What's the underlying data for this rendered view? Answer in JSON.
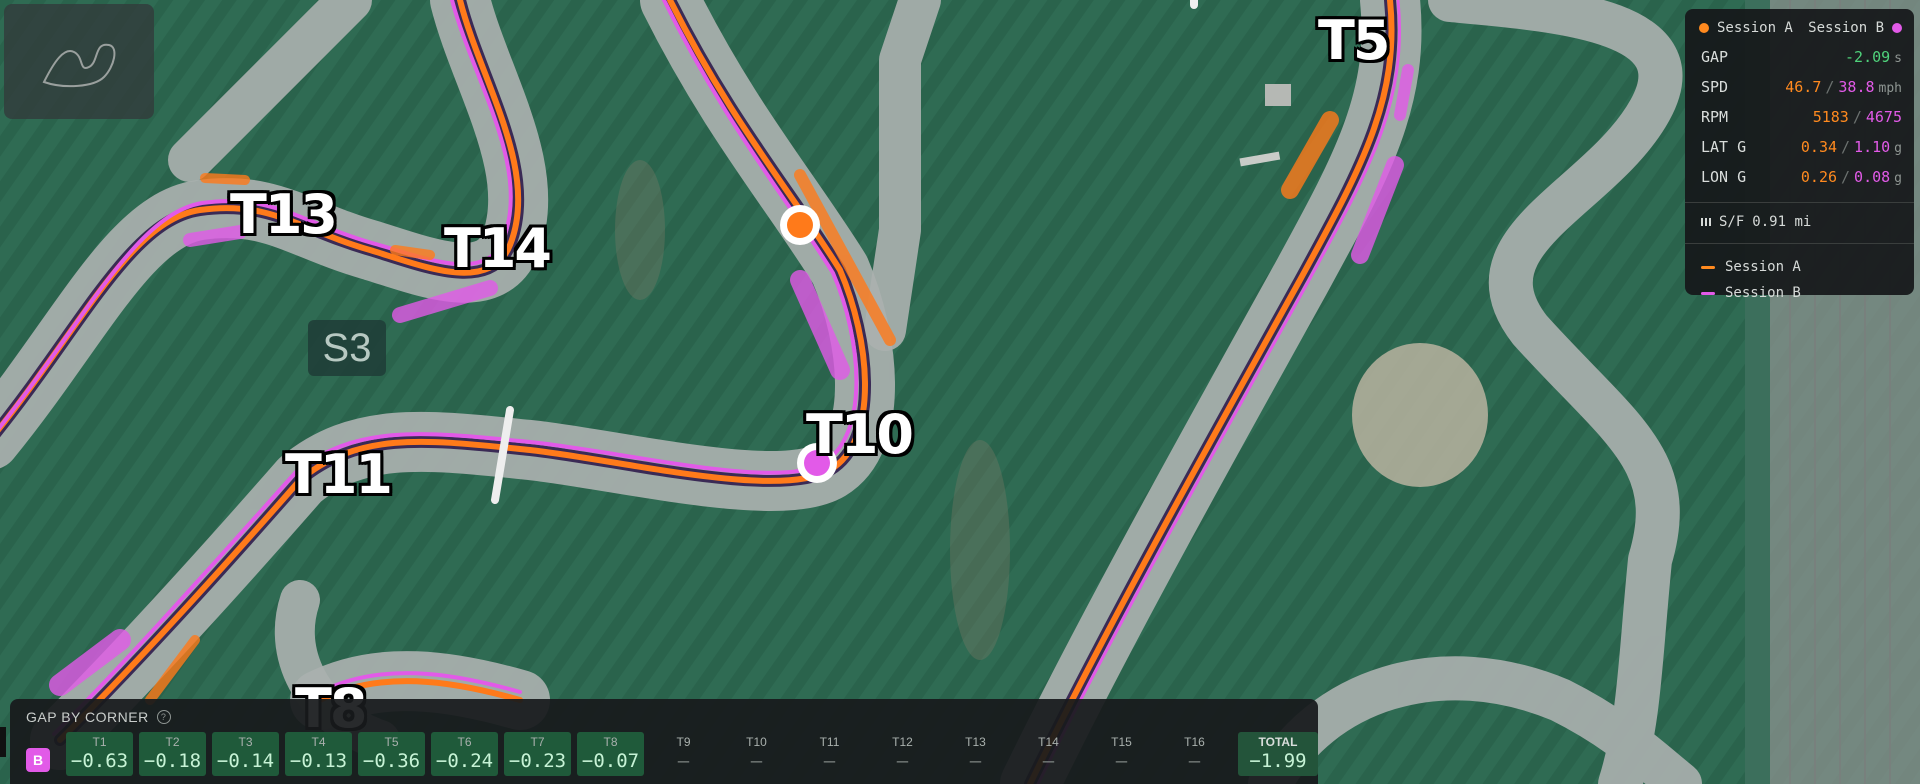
{
  "map": {
    "turns": [
      "T13",
      "T14",
      "T11",
      "T10",
      "T5",
      "T8"
    ],
    "sector": "S3"
  },
  "telemetry": {
    "session_a": "Session A",
    "session_b": "Session B",
    "rows": [
      {
        "key": "GAP",
        "value": "-2.09",
        "unit": "s"
      },
      {
        "key": "SPD",
        "a": "46.7",
        "sep": "/",
        "b": "38.8",
        "unit": "mph"
      },
      {
        "key": "RPM",
        "a": "5183",
        "sep": "/",
        "b": "4675",
        "unit": ""
      },
      {
        "key": "LAT G",
        "a": "0.34",
        "sep": "/",
        "b": "1.10",
        "unit": "g"
      },
      {
        "key": "LON G",
        "a": "0.26",
        "sep": "/",
        "b": "0.08",
        "unit": "g"
      }
    ],
    "sf_label": "S/F",
    "sf_value": "0.91 mi",
    "legend": [
      "Session A",
      "Session B"
    ],
    "colors": {
      "session_a": "#ff8a1f",
      "session_b": "#e25ae8",
      "gap_positive": "#4fd27b"
    }
  },
  "gap": {
    "title": "GAP BY CORNER",
    "help_icon": "?",
    "badge": "B",
    "corners": [
      {
        "name": "T1",
        "value": "−0.63"
      },
      {
        "name": "T2",
        "value": "−0.18"
      },
      {
        "name": "T3",
        "value": "−0.14"
      },
      {
        "name": "T4",
        "value": "−0.13"
      },
      {
        "name": "T5",
        "value": "−0.36"
      },
      {
        "name": "T6",
        "value": "−0.24"
      },
      {
        "name": "T7",
        "value": "−0.23"
      },
      {
        "name": "T8",
        "value": "−0.07"
      },
      {
        "name": "T9",
        "value": "—"
      },
      {
        "name": "T10",
        "value": "—"
      },
      {
        "name": "T11",
        "value": "—"
      },
      {
        "name": "T12",
        "value": "—"
      },
      {
        "name": "T13",
        "value": "—"
      },
      {
        "name": "T14",
        "value": "—"
      },
      {
        "name": "T15",
        "value": "—"
      },
      {
        "name": "T16",
        "value": "—"
      }
    ],
    "total_label": "TOTAL",
    "total_value": "−1.99"
  }
}
